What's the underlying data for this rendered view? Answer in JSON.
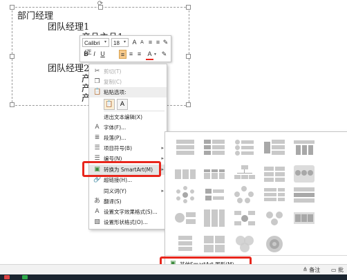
{
  "outline": {
    "level1": "部门经理",
    "lines": [
      "团队经理1",
      "产品主品1",
      "产",
      "产",
      "团队经理2",
      "产",
      "产",
      "产"
    ]
  },
  "mini_toolbar": {
    "font_name": "Calibri (正",
    "font_size": "18",
    "buttons_row1": [
      "A",
      "A",
      "≡",
      "≡",
      "✎"
    ],
    "buttons_row2": [
      "B",
      "I",
      "U",
      "≡",
      "≡",
      "≡",
      "A",
      "✎"
    ],
    "font_color": "#e8261c"
  },
  "context_menu": {
    "items": [
      {
        "label": "剪切(T)",
        "icon": "scissors-icon"
      },
      {
        "label": "复制(C)",
        "icon": "copy-icon"
      },
      {
        "label": "粘贴选项:",
        "icon": "paste-icon"
      },
      {
        "label": "退出文本编辑(X)",
        "icon": ""
      },
      {
        "label": "字体(F)...",
        "icon": "font-icon"
      },
      {
        "label": "段落(P)...",
        "icon": "paragraph-icon"
      },
      {
        "label": "项目符号(B)",
        "icon": "bullets-icon"
      },
      {
        "label": "编号(N)",
        "icon": "numbering-icon"
      },
      {
        "label": "转换为 SmartArt(M)",
        "icon": "smartart-icon"
      },
      {
        "label": "超链接(H)...",
        "icon": "link-icon"
      },
      {
        "label": "同义词(Y)",
        "icon": ""
      },
      {
        "label": "翻译(S)",
        "icon": "translate-icon"
      },
      {
        "label": "设置文字效果格式(S)...",
        "icon": "text-effects-icon"
      },
      {
        "label": "设置形状格式(O)...",
        "icon": "shape-format-icon"
      }
    ]
  },
  "gallery": {
    "more_label": "其他SmartArt 图形(M)..."
  },
  "statusbar": {
    "notes_label": "备注",
    "comments_label": "批"
  }
}
